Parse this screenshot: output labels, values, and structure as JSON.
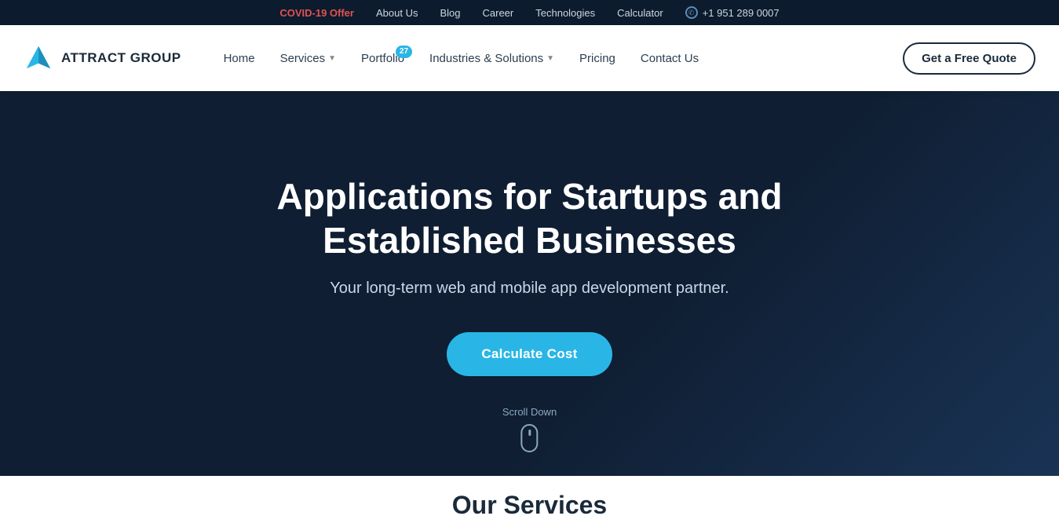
{
  "topbar": {
    "covid_label": "COVID-19 Offer",
    "links": [
      {
        "label": "About Us"
      },
      {
        "label": "Blog"
      },
      {
        "label": "Career"
      },
      {
        "label": "Technologies"
      },
      {
        "label": "Calculator"
      }
    ],
    "phone": "+1 951 289 0007"
  },
  "navbar": {
    "logo_text": "ATTRACT GROUP",
    "nav_items": [
      {
        "label": "Home",
        "has_dropdown": false,
        "has_badge": false
      },
      {
        "label": "Services",
        "has_dropdown": true,
        "has_badge": false
      },
      {
        "label": "Portfolio",
        "has_dropdown": false,
        "has_badge": true,
        "badge": "27"
      },
      {
        "label": "Industries & Solutions",
        "has_dropdown": true,
        "has_badge": false
      },
      {
        "label": "Pricing",
        "has_dropdown": false,
        "has_badge": false
      },
      {
        "label": "Contact Us",
        "has_dropdown": false,
        "has_badge": false
      }
    ],
    "cta_label": "Get a Free Quote"
  },
  "hero": {
    "heading": "Applications for Startups and Established Businesses",
    "subheading": "Your long-term web and mobile app development partner.",
    "cta_label": "Calculate Cost",
    "scroll_label": "Scroll Down"
  },
  "services_section": {
    "heading": "Our Services"
  }
}
